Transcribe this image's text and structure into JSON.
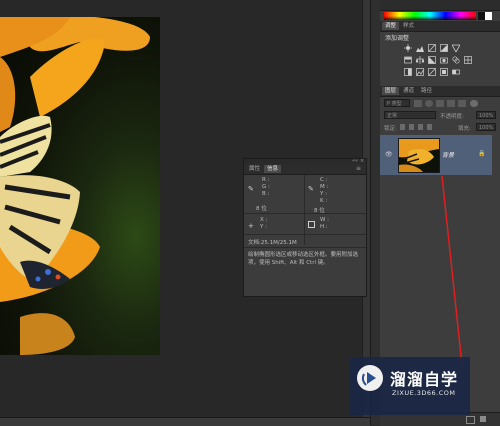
{
  "color_panel": {
    "tab_swatches": "",
    "gradient_colors": [
      "#ff0000",
      "#ffff00",
      "#00ff00",
      "#00ffff",
      "#0000ff",
      "#ff00ff",
      "#ff0000"
    ]
  },
  "adjustments_panel": {
    "tabs": [
      "调整",
      "样式"
    ],
    "title": "添加调整"
  },
  "layers_panel": {
    "tabs": [
      "图层",
      "通道",
      "路径"
    ],
    "kind_filter": "P 类型",
    "blend_mode": "正常",
    "opacity_label": "不透明度:",
    "opacity_value": "100%",
    "lock_label": "锁定:",
    "fill_label": "填充:",
    "fill_value": "100%",
    "layer_name": "背景"
  },
  "info_panel": {
    "tabs": [
      "属性",
      "信息"
    ],
    "rgb_labels": [
      "R :",
      "G :",
      "B :"
    ],
    "bit_left": "8 位",
    "cmyk_labels": [
      "C :",
      "M :",
      "Y :",
      "K :"
    ],
    "bit_right": "8 位",
    "xy_labels": [
      "X :",
      "Y :"
    ],
    "wh_labels": [
      "W :",
      "H :"
    ],
    "doc_size": "文档:25.1M/25.1M",
    "hint": "绘制椭圆形选区或移动选区外框。要用附加选项，使用 Shift、Alt 和 Ctrl 键。"
  },
  "watermark": {
    "brand": "溜溜自学",
    "url": "ZIXUE.3D66.COM"
  }
}
